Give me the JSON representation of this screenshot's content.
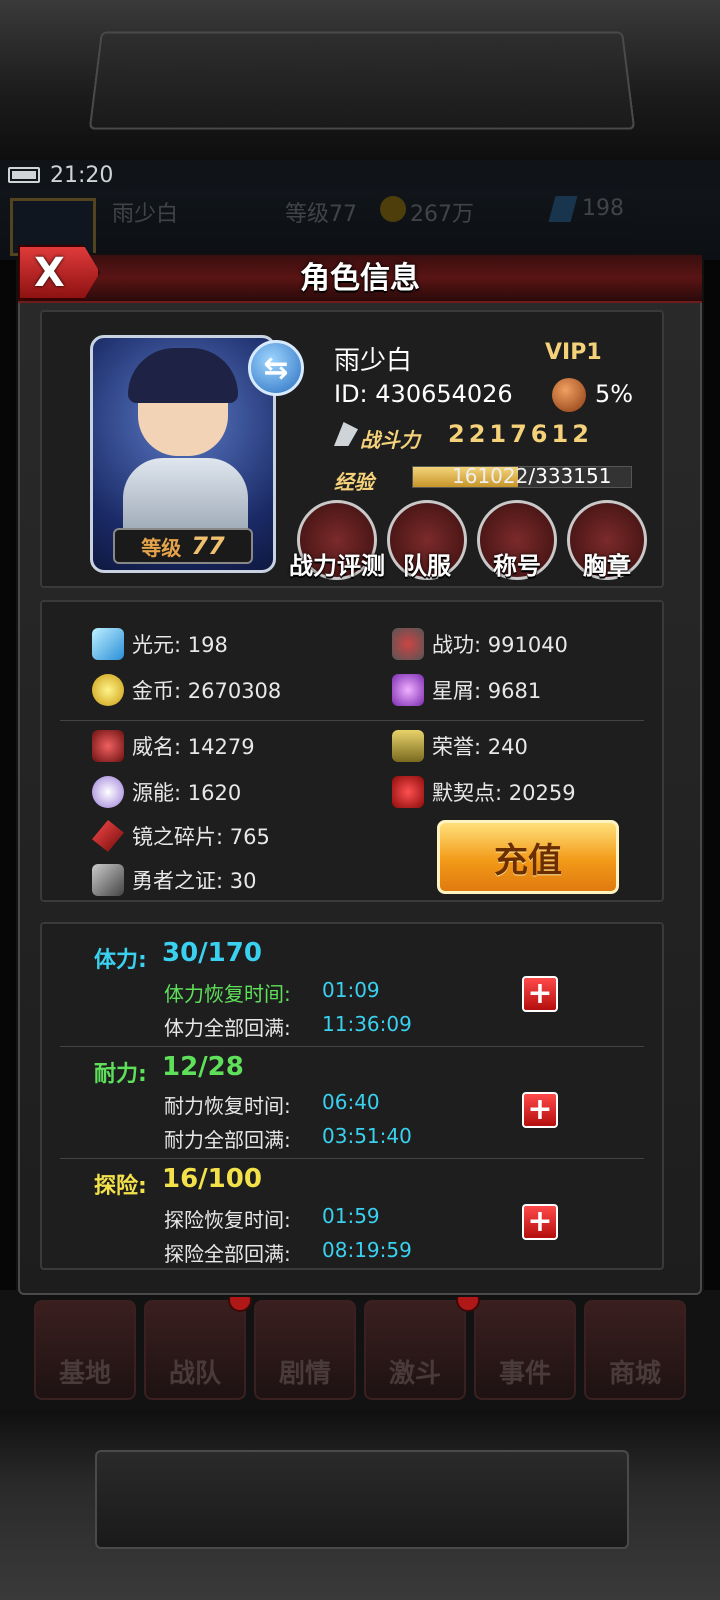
{
  "status_bar": {
    "time": "21:20"
  },
  "background_hud": {
    "name": "雨少白",
    "level": "等级77",
    "gold": "267万",
    "gems": "198",
    "combat_label": "战斗力2217612",
    "stamina": "30/170",
    "endurance": "12/28"
  },
  "dialog": {
    "title": "角色信息",
    "close_label": "X"
  },
  "profile": {
    "name": "雨少白",
    "vip": "VIP1",
    "id": "ID: 430654026",
    "bonus_percent": "5%",
    "combat_label": "战斗力",
    "combat_value": "2217612",
    "exp_label": "经验",
    "exp_current": "161022",
    "exp_max": "/333151",
    "exp_fraction": 0.4833,
    "level_label": "等级",
    "level_value": "77"
  },
  "features": [
    {
      "label": "战力评测",
      "icon": "power-eval-icon"
    },
    {
      "label": "队服",
      "icon": "uniform-icon"
    },
    {
      "label": "称号",
      "icon": "title-icon"
    },
    {
      "label": "胸章",
      "icon": "badge-icon"
    }
  ],
  "resources": {
    "guangyuan": "光元: 198",
    "zhangong": "战功: 991040",
    "jinbi": "金币: 2670308",
    "xingxie": "星屑: 9681",
    "weiming": "威名: 14279",
    "rongyu": "荣誉: 240",
    "yuanneng": "源能: 1620",
    "moqidian": "默契点: 20259",
    "jingzhisuipian": "镜之碎片: 765",
    "yongzhezhizheng": "勇者之证: 30"
  },
  "recharge_label": "充值",
  "stats": {
    "stamina": {
      "label": "体力:",
      "value": "30/170",
      "recover_label": "体力恢复时间:",
      "recover_time": "01:09",
      "full_label": "体力全部回满:",
      "full_time": "11:36:09"
    },
    "endurance": {
      "label": "耐力:",
      "value": "12/28",
      "recover_label": "耐力恢复时间:",
      "recover_time": "06:40",
      "full_label": "耐力全部回满:",
      "full_time": "03:51:40"
    },
    "explore": {
      "label": "探险:",
      "value": "16/100",
      "recover_label": "探险恢复时间:",
      "recover_time": "01:59",
      "full_label": "探险全部回满:",
      "full_time": "08:19:59"
    }
  },
  "bottom_nav": [
    "基地",
    "战队",
    "剧情",
    "激斗",
    "事件",
    "商城"
  ],
  "colors": {
    "accent_red": "#b01818",
    "gold": "#f5d27a",
    "cyan": "#3ad1f0",
    "green": "#5ee05a",
    "yellow": "#f3e14a"
  }
}
